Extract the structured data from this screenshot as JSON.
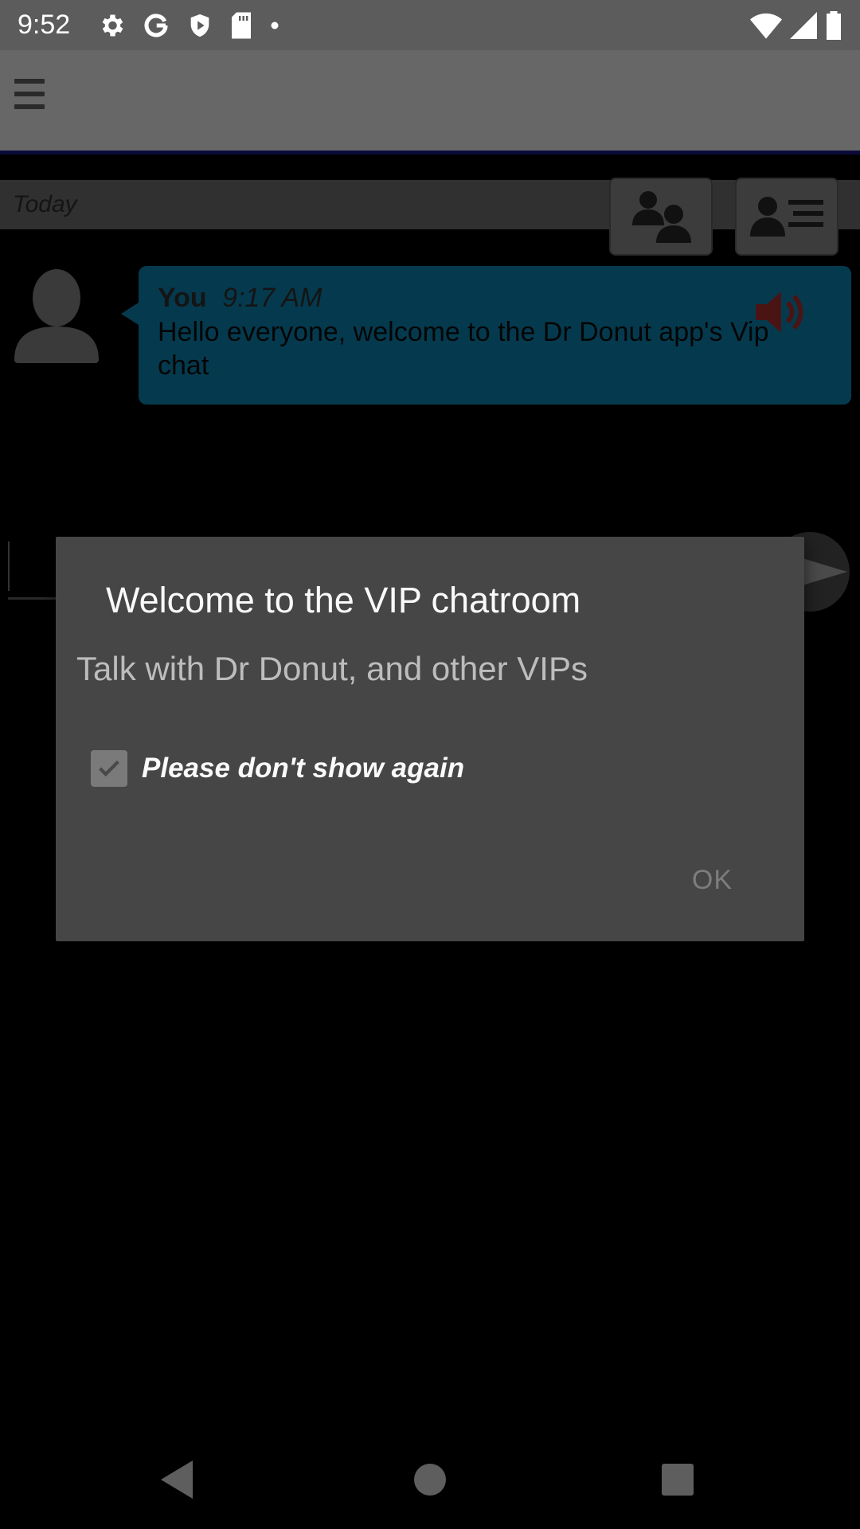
{
  "status_bar": {
    "time": "9:52",
    "left_icons": [
      "settings-icon",
      "google-icon",
      "shield-icon",
      "sd-card-icon",
      "dot-icon"
    ],
    "right_icons": [
      "wifi-icon",
      "signal-icon",
      "battery-icon"
    ]
  },
  "app_bar": {
    "menu_icon": "hamburger-menu-icon"
  },
  "chat": {
    "date_label": "Today",
    "buttons": [
      "users-icon",
      "profile-list-icon"
    ],
    "messages": [
      {
        "sender": "You",
        "time": "9:17 AM",
        "text": "Hello everyone, welcome to the Dr Donut app's Vip chat"
      }
    ]
  },
  "dialog": {
    "title": "Welcome to the VIP chatroom",
    "message": "Talk with Dr Donut, and other VIPs",
    "checkbox_label": "Please don't show again",
    "checkbox_checked": true,
    "ok_label": "OK"
  },
  "colors": {
    "bubble": "#053a4e",
    "app_bar": "#676767",
    "dialog": "#464646"
  }
}
